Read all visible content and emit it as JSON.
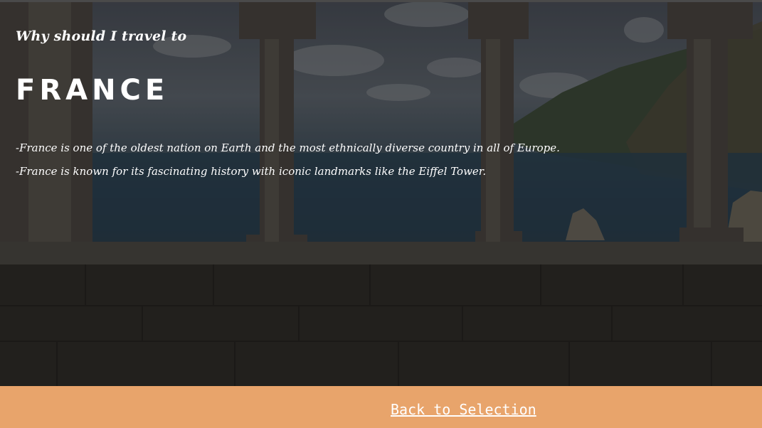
{
  "hero": {
    "subtitle": "Why should I travel to",
    "title": "FRANCE",
    "facts": [
      "-France is one of the oldest nation on Earth and the most ethnically diverse country in all of Europe.",
      "-France is known for its fascinating history with iconic landmarks like the Eiffel Tower."
    ]
  },
  "footer": {
    "back_label": "Back to Selection",
    "background_color": "#e8a46b"
  }
}
